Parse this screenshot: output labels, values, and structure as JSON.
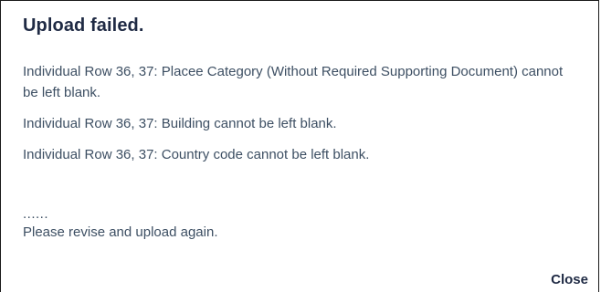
{
  "dialog": {
    "title": "Upload failed.",
    "messages": [
      "Individual Row 36, 37: Placee Category (Without Required Supporting Document) cannot be left blank.",
      "Individual Row 36, 37: Building cannot be left blank.",
      "Individual Row 36, 37: Country code cannot be left blank."
    ],
    "ellipsis": "......",
    "instruction": "Please revise and upload again.",
    "close_label": "Close"
  },
  "colors": {
    "title": "#1f2a44",
    "body_text": "#3d4f63",
    "border": "#1a1a1a"
  }
}
